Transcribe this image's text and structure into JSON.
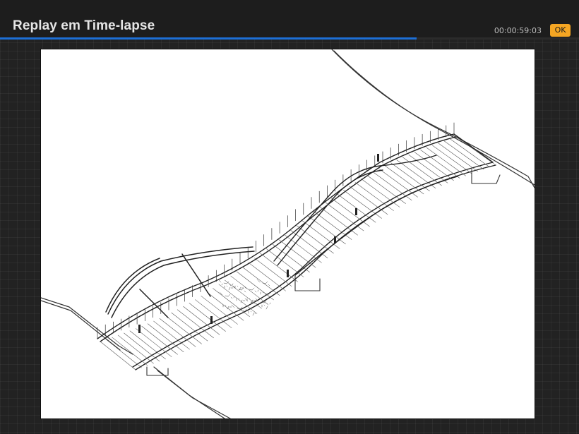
{
  "header": {
    "title": "Replay em Time-lapse",
    "timestamp": "00:00:59:03",
    "ok_label": "OK"
  },
  "playback": {
    "progress": 0.72
  },
  "colors": {
    "accent": "#f5a623",
    "progress": "#1d6fd6",
    "background": "#222222"
  }
}
